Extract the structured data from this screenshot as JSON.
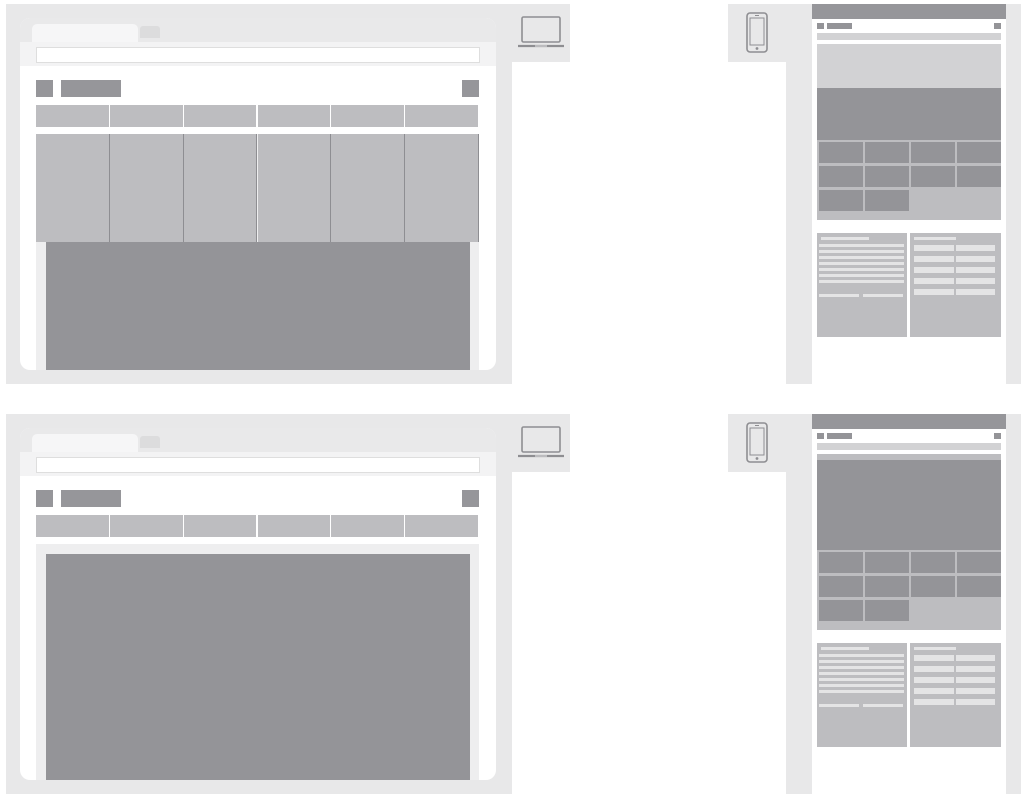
{
  "wireframes": [
    {
      "name": "desktop-wireframe-top",
      "device": "laptop",
      "variant": "dropdown-menu-open",
      "nav_items": 6,
      "menu_columns": 6
    },
    {
      "name": "mobile-wireframe-top",
      "device": "phone",
      "variant": "hero-banner",
      "grid_tiles": 10
    },
    {
      "name": "desktop-wireframe-bottom",
      "device": "laptop",
      "variant": "menu-closed",
      "nav_items": 6,
      "menu_columns": 0
    },
    {
      "name": "mobile-wireframe-bottom",
      "device": "phone",
      "variant": "tall-banner",
      "grid_tiles": 10
    }
  ],
  "icons": {
    "laptop": "laptop-icon",
    "phone": "smartphone-icon"
  },
  "colors": {
    "background": "#ffffff",
    "frame": "#e8e8e9",
    "dark_block": "#949498",
    "mid_block": "#bdbdc0",
    "light_block": "#d2d2d4"
  }
}
